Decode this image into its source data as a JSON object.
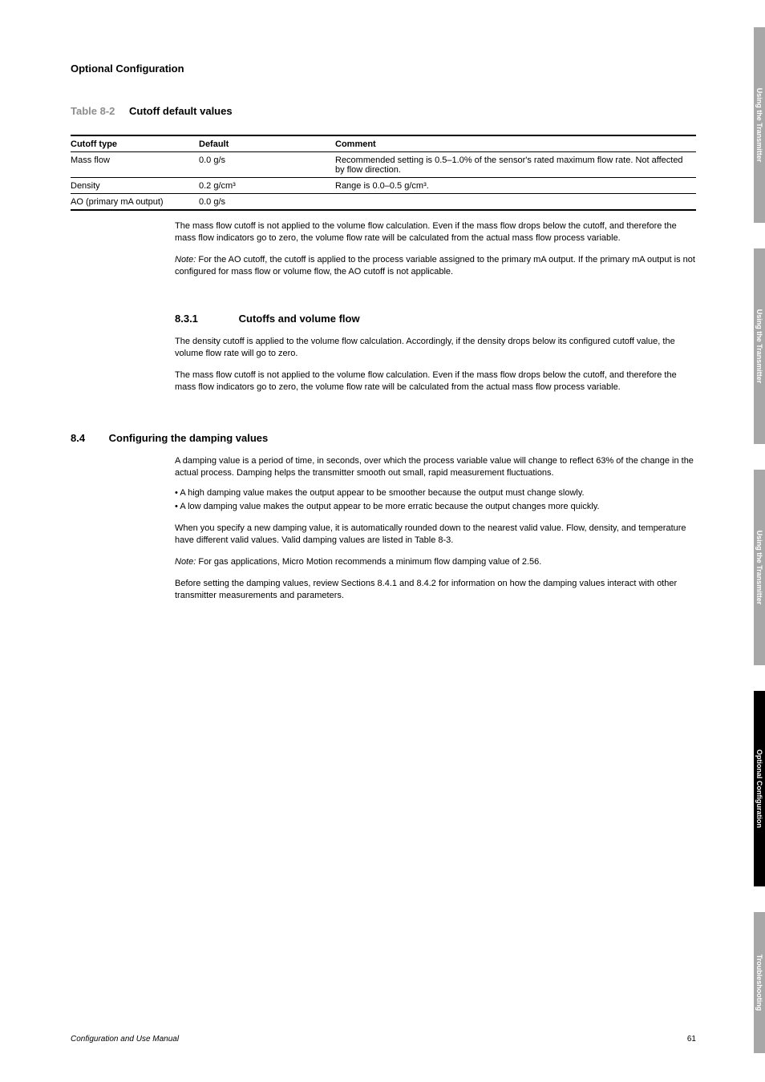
{
  "runningHead": "Optional Configuration",
  "tableCaption": {
    "label": "Table 8-2",
    "title": "Cutoff default values"
  },
  "table": {
    "headers": [
      "Cutoff type",
      "Default",
      "Comment"
    ],
    "rows": [
      [
        "Mass flow",
        "0.0 g/s",
        "Recommended setting is 0.5–1.0% of the sensor's rated maximum flow rate. Not affected by flow direction."
      ],
      [
        "Density",
        "0.2 g/cm³",
        "Range is 0.0–0.5 g/cm³."
      ],
      [
        "AO (primary mA output)",
        "0.0 g/s",
        ""
      ]
    ]
  },
  "afterTablePara": "The mass flow cutoff is not applied to the volume flow calculation. Even if the mass flow drops below the cutoff, and therefore the mass flow indicators go to zero, the volume flow rate will be calculated from the actual mass flow process variable.",
  "note": {
    "label": "Note:",
    "text": "For the AO cutoff, the cutoff is applied to the process variable assigned to the primary mA output. If the primary mA output is not configured for mass flow or volume flow, the AO cutoff is not applicable."
  },
  "sec831": {
    "num": "8.3.1",
    "title": "Cutoffs and volume flow",
    "p1": "The density cutoff is applied to the volume flow calculation. Accordingly, if the density drops below its configured cutoff value, the volume flow rate will go to zero.",
    "p2": "The mass flow cutoff is not applied to the volume flow calculation. Even if the mass flow drops below the cutoff, and therefore the mass flow indicators go to zero, the volume flow rate will be calculated from the actual mass flow process variable."
  },
  "sec84": {
    "num": "8.4",
    "title": "Configuring the damping values",
    "p1": "A damping value is a period of time, in seconds, over which the process variable value will change to reflect 63% of the change in the actual process. Damping helps the transmitter smooth out small, rapid measurement fluctuations.",
    "li1": "A high damping value makes the output appear to be smoother because the output must change slowly.",
    "li2": "A low damping value makes the output appear to be more erratic because the output changes more quickly.",
    "p2": "When you specify a new damping value, it is automatically rounded down to the nearest valid value. Flow, density, and temperature have different valid values. Valid damping values are listed in Table 8-3.",
    "note": {
      "label": "Note:",
      "text": "For gas applications, Micro Motion recommends a minimum flow damping value of 2.56."
    },
    "p3": "Before setting the damping values, review Sections 8.4.1 and 8.4.2 for information on how the damping values interact with other transmitter measurements and parameters."
  },
  "tabs": [
    "Using the Transmitter",
    "Using the Transmitter",
    "Using the Transmitter",
    "Optional Configuration",
    "Troubleshooting"
  ],
  "footer": {
    "left": "Configuration and Use Manual",
    "right": "61"
  }
}
